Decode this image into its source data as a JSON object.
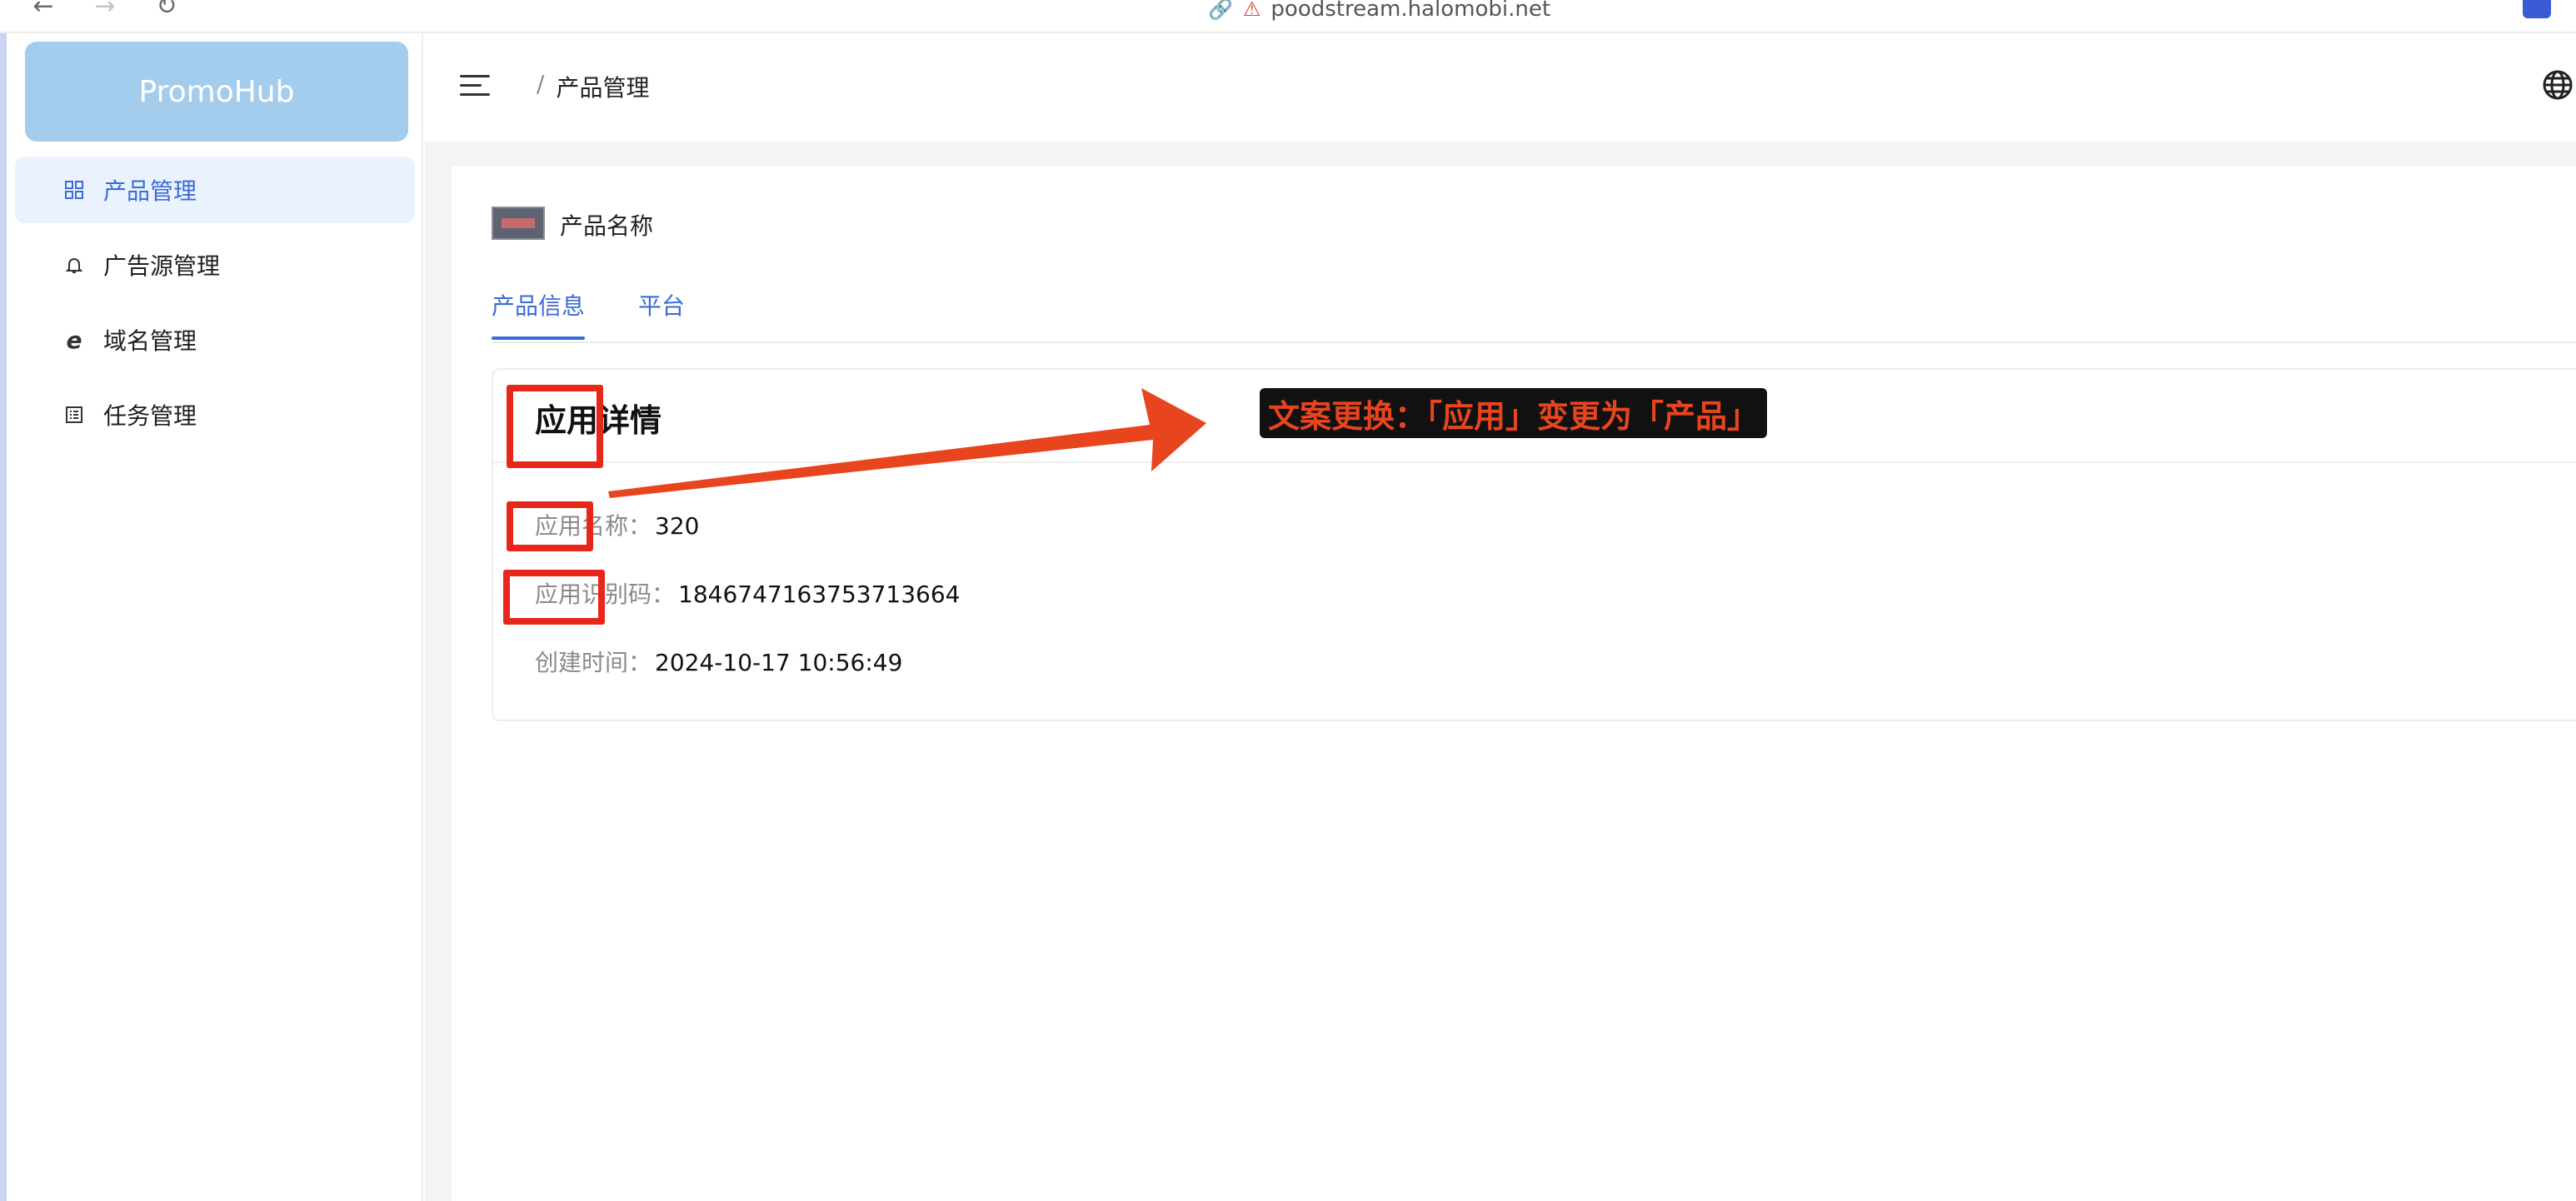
{
  "browser": {
    "back_icon": "arrow-left-icon",
    "forward_icon": "arrow-right-icon",
    "reload_icon": "reload-icon",
    "url": "poodstream.halomobi.net"
  },
  "sidebar": {
    "logo": "PromoHub",
    "items": [
      {
        "label": "产品管理",
        "icon": "grid-icon",
        "active": true
      },
      {
        "label": "广告源管理",
        "icon": "bell-icon",
        "active": false
      },
      {
        "label": "域名管理",
        "icon": "browser-e-icon",
        "active": false
      },
      {
        "label": "任务管理",
        "icon": "list-icon",
        "active": false
      }
    ]
  },
  "header": {
    "menu_icon": "menu-fold-icon",
    "breadcrumb_sep": "/",
    "breadcrumb_current": "产品管理",
    "language_icon": "globe-icon"
  },
  "product": {
    "name": "产品名称"
  },
  "tabs": [
    {
      "label": "产品信息",
      "active": true
    },
    {
      "label": "平台",
      "active": false
    }
  ],
  "detail": {
    "title": "应用详情",
    "fields": [
      {
        "label": "应用名称：",
        "value": "320"
      },
      {
        "label": "应用识别码：",
        "value": "1846747163753713664"
      },
      {
        "label": "创建时间：",
        "value": "2024-10-17 10:56:49"
      }
    ]
  },
  "annotation": {
    "text": "文案更换：「应用」变更为「产品」",
    "color": "#e8261a"
  },
  "colors": {
    "accent": "#3b6bd6",
    "logo_bg": "#a4cced",
    "active_menu_bg": "#eaf2fd",
    "annotation_red": "#e8261a"
  }
}
